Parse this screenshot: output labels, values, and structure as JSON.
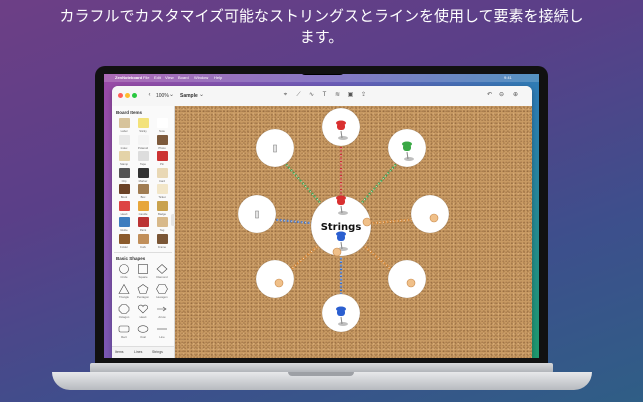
{
  "headline": {
    "line1": "カラフルでカスタマイズ可能なストリングスとラインを使用して要素を接続し",
    "line2": "ます。"
  },
  "menubar": {
    "app_name": "ZenNoteboard",
    "items": [
      "File",
      "Edit",
      "View",
      "Board",
      "Window",
      "Help"
    ],
    "time": "9:41"
  },
  "toolbar": {
    "zoom": "100%",
    "document": "Sample"
  },
  "sidebar": {
    "board_items_title": "Board Items",
    "board_items": [
      "Label",
      "Sticky",
      "Note",
      "Index",
      "Polaroid",
      "Photo",
      "Stamp",
      "Tape",
      "Pin",
      "Clip",
      "Marker",
      "Card",
      "Book",
      "Box",
      "Ticket",
      "Heart",
      "Candle",
      "Badge",
      "Globe",
      "Paint",
      "Tag",
      "Folder",
      "Cork",
      "Frame"
    ],
    "basic_shapes_title": "Basic Shapes",
    "basic_shapes": [
      "Circle",
      "Square",
      "Diamond",
      "Triangle",
      "Pentagon",
      "Hexagon",
      "Octagon",
      "Heart",
      "Arrow",
      "Rect",
      "Oval",
      "Line"
    ],
    "bottom": [
      "Items",
      "Lines",
      "Strings"
    ]
  },
  "canvas": {
    "center_label": "Strings",
    "colors": {
      "red_pin": "#d93030",
      "green_pin": "#3aa845",
      "blue_pin": "#2b5fd0",
      "string_red": "#c83232",
      "string_green": "#3b9d4a",
      "string_blue": "#3a6ec8",
      "string_orange": "#d7822a"
    }
  }
}
